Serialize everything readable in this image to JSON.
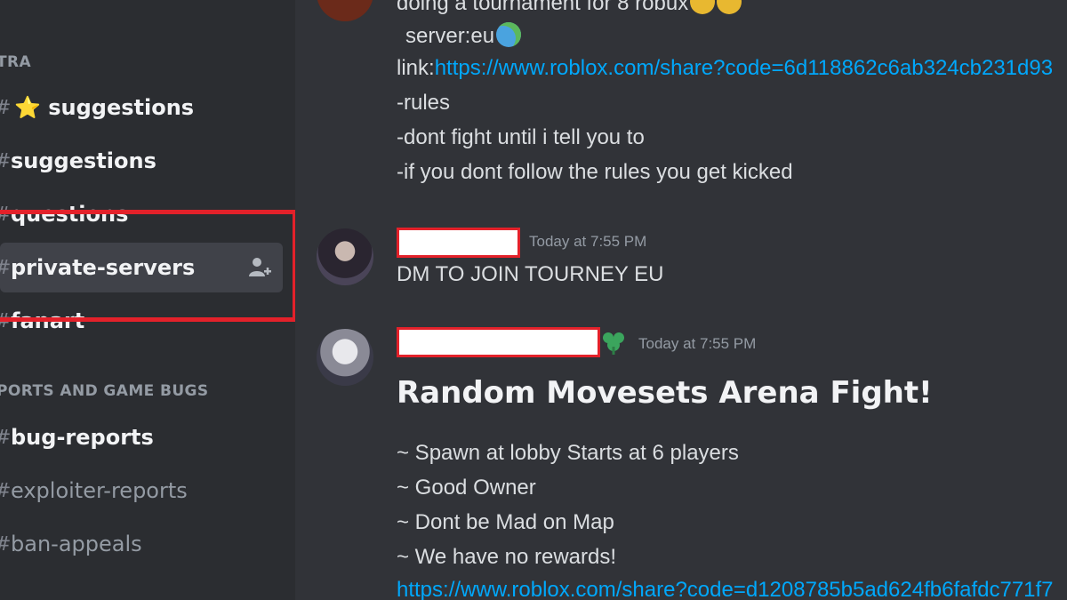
{
  "sidebar": {
    "categories": [
      {
        "label": "TRA"
      },
      {
        "label": "PORTS AND GAME BUGS"
      }
    ],
    "channels": [
      {
        "label": "⭐ suggestions"
      },
      {
        "label": "suggestions"
      },
      {
        "label": "questions"
      },
      {
        "label": "private-servers"
      },
      {
        "label": "fanart"
      },
      {
        "label": "bug-reports"
      },
      {
        "label": "exploiter-reports"
      },
      {
        "label": "ban-appeals"
      }
    ]
  },
  "messages": {
    "first": {
      "line1": "doing a tournament for 8 robux",
      "server_prefix": "server:eu",
      "link_prefix": "link:",
      "link": "https://www.roblox.com/share?code=6d118862c6ab324cb231d93",
      "rules": " -rules",
      "rule1": "-dont fight until i tell you to",
      "rule2": "-if you dont follow the rules you get kicked"
    },
    "second": {
      "timestamp": "Today at 7:55 PM",
      "text": "DM TO JOIN TOURNEY EU"
    },
    "third": {
      "timestamp": "Today at 7:55 PM",
      "heading": "Random Movesets Arena Fight!",
      "line1": "~ Spawn at lobby Starts at 6 players",
      "line2": "~ Good Owner",
      "line3": "~ Dont be Mad on Map",
      "line4": "~ We have no rewards!",
      "link": "https://www.roblox.com/share?code=d1208785b5ad624fb6fafdc771f7"
    }
  },
  "colors": {
    "background": "#313338",
    "sidebar": "#2b2d31",
    "link": "#00a8fc",
    "highlight": "#e3212a"
  }
}
